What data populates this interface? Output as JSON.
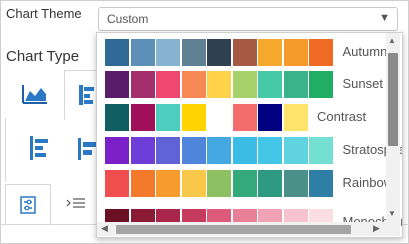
{
  "chart_theme": {
    "label": "Chart Theme",
    "selected": "Custom",
    "caret_icon": "triangle-down"
  },
  "chart_type": {
    "label": "Chart Type"
  },
  "themes": [
    {
      "name": "Autumn",
      "colors": [
        "#2f6a96",
        "#5b8fb8",
        "#86b3d1",
        "#5f7f93",
        "#2f4050",
        "#a65a43",
        "#f4a92c",
        "#f49a29",
        "#ef6b23"
      ]
    },
    {
      "name": "Sunset",
      "colors": [
        "#5b1b6b",
        "#a3306d",
        "#ef476f",
        "#f78955",
        "#ffd24a",
        "#a7d16a",
        "#45c9a6",
        "#3ab38a",
        "#1fae63"
      ]
    },
    {
      "name": "Contrast",
      "colors": [
        "#105e61",
        "#a0105a",
        "#4dcdbd",
        "#ffd400",
        "#ffffff",
        "#f46d6d",
        "#000080",
        "#ffe36a"
      ]
    },
    {
      "name": "Stratosphere",
      "colors": [
        "#7b1fc8",
        "#6f3ed8",
        "#5f63d6",
        "#4f86dc",
        "#45a8e2",
        "#3bbce6",
        "#44c7e7",
        "#5fd3e0",
        "#74e0d1"
      ]
    },
    {
      "name": "Rainbow",
      "colors": [
        "#f04e4e",
        "#f37a2b",
        "#f79b2e",
        "#f7c84a",
        "#8cc063",
        "#34a97c",
        "#2e9a82",
        "#4a8f88",
        "#2f7ea6"
      ]
    },
    {
      "name": "Monochrome",
      "colors": [
        "#6b0f24",
        "#8a1a36",
        "#a8264a",
        "#c63a5f",
        "#dd5a7a",
        "#ea7f98",
        "#f2a2b5",
        "#f7c3d0",
        "#fbdde4"
      ]
    }
  ]
}
